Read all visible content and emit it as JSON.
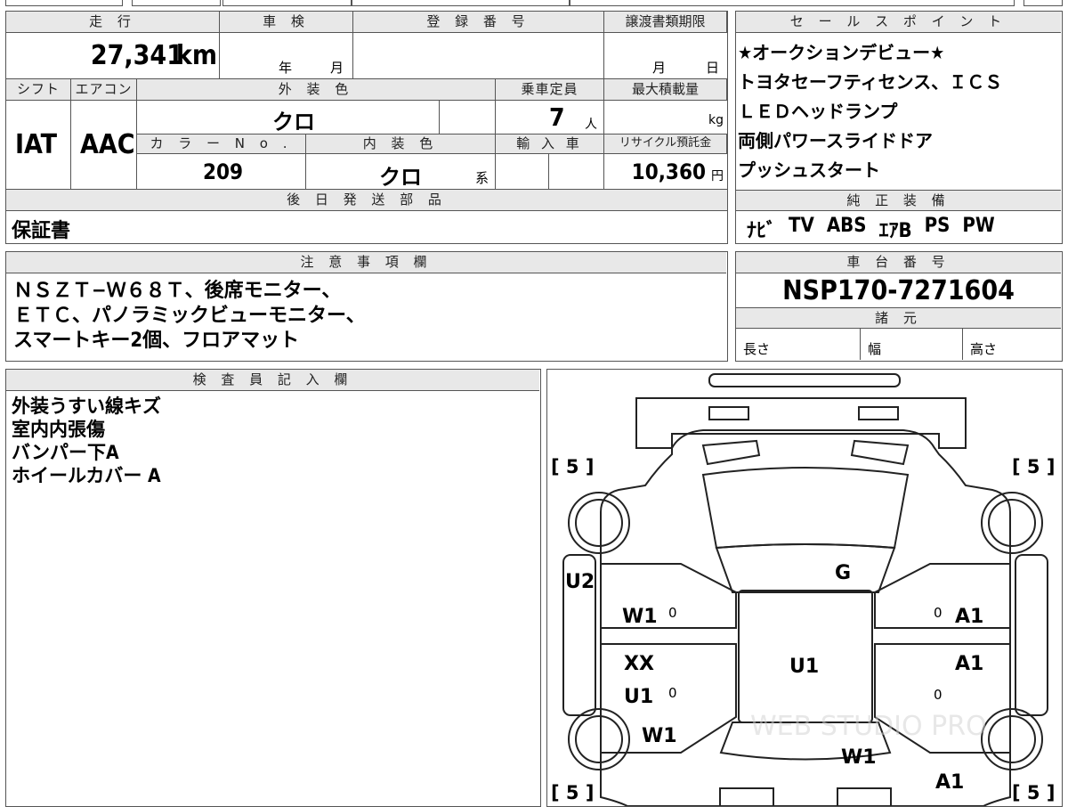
{
  "header": {
    "mileage_label": "走 行",
    "inspection_label": "車 検",
    "registration_label": "登 録 番 号",
    "transfer_deadline_label": "譲渡書類期限",
    "sales_point_label": "セ ー ル ス ポ イ ン ト",
    "shift_label": "シフト",
    "aircon_label": "エアコン",
    "exterior_color_label": "外 装 色",
    "capacity_label": "乗車定員",
    "max_load_label": "最大積載量",
    "color_no_label": "カ ラ ー N o .",
    "interior_color_label": "内 装 色",
    "import_label": "輸 入 車",
    "recycle_label": "リサイクル預託金",
    "later_parts_label": "後 日 発 送 部 品",
    "genuine_equipment_label": "純 正 装 備",
    "notes_label": "注 意 事 項 欄",
    "chassis_label": "車 台 番 号",
    "specs_label": "諸 元",
    "inspector_label": "検 査 員 記 入 欄"
  },
  "vehicle": {
    "mileage": "27,341",
    "mileage_unit": "km",
    "inspection_year_unit": "年",
    "inspection_month_unit": "月",
    "deadline_month_unit": "月",
    "deadline_day_unit": "日",
    "shift": "IAT",
    "aircon": "AAC",
    "exterior_color": "クロ",
    "capacity": "7",
    "capacity_unit": "人",
    "load_unit": "kg",
    "color_no": "209",
    "interior_color": "クロ",
    "interior_suffix": "系",
    "recycle_fee": "10,360",
    "recycle_unit": "円",
    "later_parts": "保証書",
    "chassis_no": "NSP170-7271604",
    "length_label": "長さ",
    "width_label": "幅",
    "height_label": "高さ"
  },
  "sales_points": [
    "★オークションデビュー★",
    "トヨタセーフティセンス、ＩＣＳ",
    "ＬＥＤヘッドランプ",
    "両側パワースライドドア",
    "プッシュスタート"
  ],
  "equipment": [
    "ﾅﾋﾞ",
    "TV",
    "ABS",
    "ｴｱB",
    "PS",
    "PW"
  ],
  "notes": [
    "ＮＳＺＴ−Ｗ６８Ｔ、後席モニター、",
    "ＥＴＣ、パノラミックビューモニター、",
    "スマートキー2個、フロアマット"
  ],
  "inspector_notes": [
    "外装うすい線キズ",
    "室内内張傷",
    "バンパー下A",
    "ホイールカバー A"
  ],
  "diagram": {
    "tire_tl": "[ 5 ]",
    "tire_tr": "[ 5 ]",
    "tire_bl": "[ 5 ]",
    "tire_br": "[ 5 ]",
    "g": "G",
    "u2": "U2",
    "w1_left_front": "W1",
    "zero_left_front": "0",
    "zero_right_front": "0",
    "a1_right_front": "A1",
    "xx": "XX",
    "u1_left": "U1",
    "zero_left_rear": "0",
    "u1_center": "U1",
    "a1_right_mid": "A1",
    "zero_right_rear": "0",
    "w1_left_rear": "W1",
    "w1_bottom": "W1",
    "a1_bottom": "A1",
    "watermark": "WEB STUDIO PRO"
  }
}
